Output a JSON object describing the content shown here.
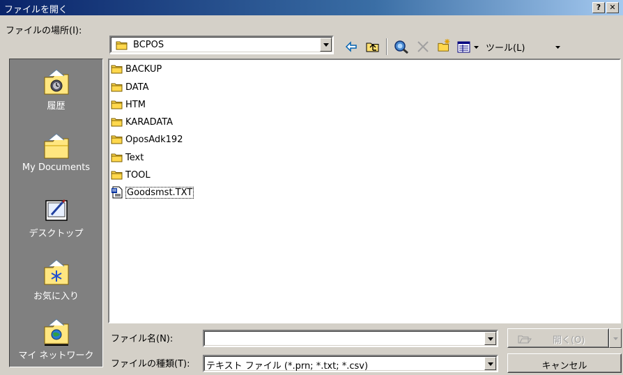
{
  "window": {
    "title": "ファイルを開く",
    "help_label": "?",
    "close_label": "✕"
  },
  "toolbar": {
    "location_label": "ファイルの場所(I):",
    "location_value": "BCPOS",
    "tools_label": "ツール(L)"
  },
  "places": [
    {
      "label": "履歴",
      "icon": "history-icon"
    },
    {
      "label": "My Documents",
      "icon": "my-documents-icon"
    },
    {
      "label": "デスクトップ",
      "icon": "desktop-icon"
    },
    {
      "label": "お気に入り",
      "icon": "favorites-icon"
    },
    {
      "label": "マイ ネットワーク",
      "icon": "network-icon"
    }
  ],
  "files": [
    {
      "name": "BACKUP",
      "type": "folder"
    },
    {
      "name": "DATA",
      "type": "folder"
    },
    {
      "name": "HTM",
      "type": "folder"
    },
    {
      "name": "KARADATA",
      "type": "folder"
    },
    {
      "name": "OposAdk192",
      "type": "folder"
    },
    {
      "name": "Text",
      "type": "folder"
    },
    {
      "name": "TOOL",
      "type": "folder"
    },
    {
      "name": "Goodsmst.TXT",
      "type": "text-file"
    }
  ],
  "bottom": {
    "filename_label": "ファイル名(N):",
    "filename_value": "",
    "filetype_label": "ファイルの種類(T):",
    "filetype_value": "テキスト ファイル (*.prn; *.txt; *.csv)",
    "open_label": "開く(O)",
    "cancel_label": "キャンセル"
  },
  "colors": {
    "titlebar_start": "#0a246a",
    "titlebar_end": "#a6caf0",
    "face": "#d4d0c8",
    "places_bg": "#808080"
  }
}
